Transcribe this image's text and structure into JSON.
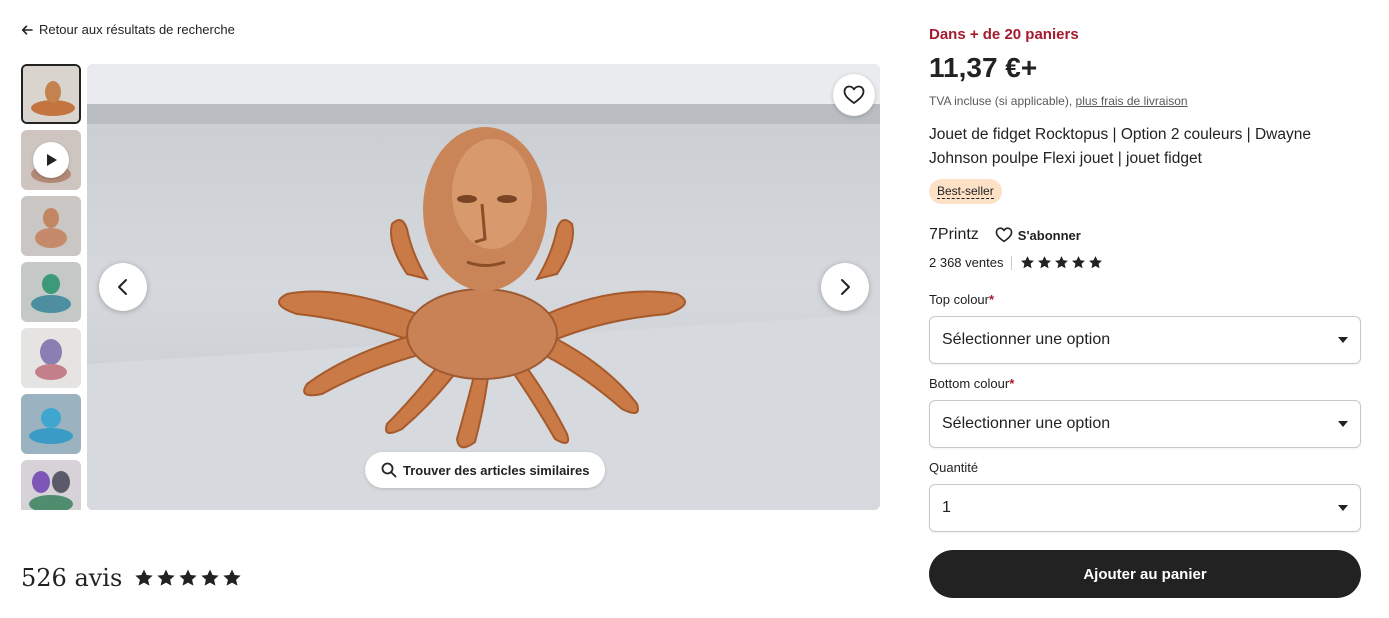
{
  "nav": {
    "back_label": "Retour aux résultats de recherche"
  },
  "gallery": {
    "thumbnails": [
      {
        "kind": "image",
        "active": true
      },
      {
        "kind": "video",
        "active": false
      },
      {
        "kind": "image",
        "active": false
      },
      {
        "kind": "image",
        "active": false
      },
      {
        "kind": "image",
        "active": false
      },
      {
        "kind": "image",
        "active": false
      },
      {
        "kind": "image",
        "active": false
      }
    ],
    "similar_label": "Trouver des articles similaires"
  },
  "reviews": {
    "count_label": "526 avis",
    "rating": 5
  },
  "product": {
    "basket_notice": "Dans + de 20 paniers",
    "price": "11,37 €+",
    "vat_text": "TVA incluse (si applicable),",
    "shipping_link": "plus frais de livraison",
    "title": "Jouet de fidget Rocktopus | Option 2 couleurs | Dwayne Johnson poulpe Flexi jouet | jouet fidget",
    "badge": "Best-seller"
  },
  "shop": {
    "name": "7Printz",
    "follow_label": "S'abonner",
    "sales": "2 368 ventes",
    "rating": 5
  },
  "options": {
    "top_colour": {
      "label": "Top colour",
      "required_mark": "*",
      "value": "Sélectionner une option"
    },
    "bottom_colour": {
      "label": "Bottom colour",
      "required_mark": "*",
      "value": "Sélectionner une option"
    },
    "quantity": {
      "label": "Quantité",
      "value": "1"
    }
  },
  "cart": {
    "add_label": "Ajouter au panier"
  },
  "colors": {
    "accent_red": "#a61a2e",
    "badge_bg": "#fde1c6",
    "button_dark": "#222222"
  }
}
